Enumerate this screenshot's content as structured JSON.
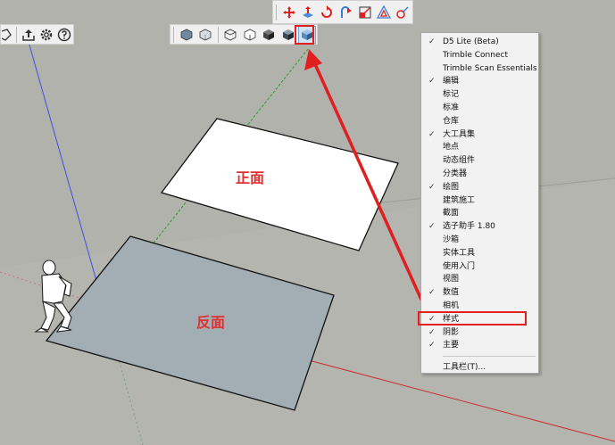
{
  "canvas": {
    "front_label": "正面",
    "back_label": "反面",
    "colors": {
      "sky": "#b2b2ad",
      "ground": "#b5b5b0",
      "front_face": "#ffffff",
      "back_face": "#a3adb4",
      "annotation": "#e02020"
    }
  },
  "toolbars": {
    "top": {
      "icons": [
        "move-icon",
        "push-pull-icon",
        "rotate-icon",
        "follow-me-icon",
        "scale-icon",
        "offset-icon",
        "tape-measure-icon"
      ]
    },
    "left": {
      "icons": [
        "partial-icon",
        "upload-icon",
        "settings-icon",
        "help-icon"
      ]
    },
    "styles": {
      "icons": [
        "xray-icon",
        "back-edges-icon",
        "wireframe-icon",
        "hidden-line-icon",
        "shaded-icon",
        "shaded-textures-icon",
        "monochrome-icon"
      ]
    }
  },
  "context_menu": {
    "items": [
      {
        "label": "D5 Lite (Beta)",
        "checked": true
      },
      {
        "label": "Trimble Connect",
        "checked": false
      },
      {
        "label": "Trimble Scan Essentials",
        "checked": false
      },
      {
        "label": "编辑",
        "checked": true
      },
      {
        "label": "标记",
        "checked": false
      },
      {
        "label": "标准",
        "checked": false
      },
      {
        "label": "仓库",
        "checked": false
      },
      {
        "label": "大工具集",
        "checked": true
      },
      {
        "label": "地点",
        "checked": false
      },
      {
        "label": "动态组件",
        "checked": false
      },
      {
        "label": "分类器",
        "checked": false
      },
      {
        "label": "绘图",
        "checked": true
      },
      {
        "label": "建筑施工",
        "checked": false
      },
      {
        "label": "截面",
        "checked": false
      },
      {
        "label": "选子助手 1.80",
        "checked": true
      },
      {
        "label": "沙箱",
        "checked": false
      },
      {
        "label": "实体工具",
        "checked": false
      },
      {
        "label": "使用入门",
        "checked": false
      },
      {
        "label": "视图",
        "checked": false
      },
      {
        "label": "数值",
        "checked": true
      },
      {
        "label": "相机",
        "checked": false
      },
      {
        "label": "样式",
        "checked": true
      },
      {
        "label": "阴影",
        "checked": true
      },
      {
        "label": "主要",
        "checked": true
      }
    ],
    "footer": {
      "label": "工具栏(T)..."
    },
    "check_glyph": "✓"
  }
}
